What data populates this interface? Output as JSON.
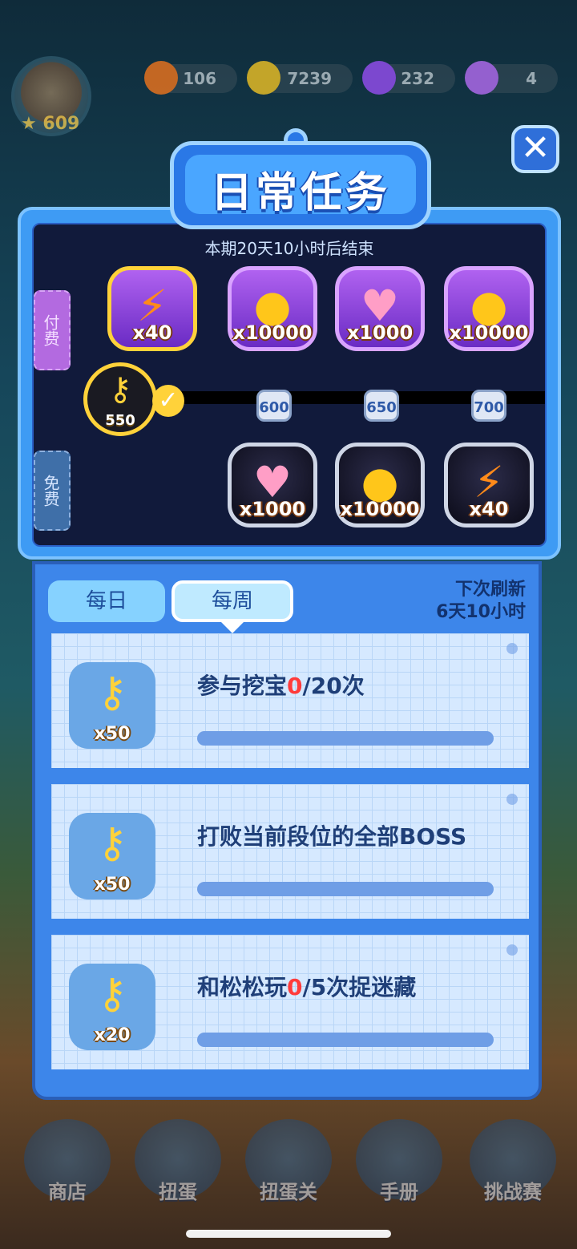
{
  "header": {
    "avatar_stars": "609",
    "resources": [
      {
        "name": "energy",
        "value": "106",
        "color": "#ff7a1a"
      },
      {
        "name": "coins",
        "value": "7239",
        "color": "#ffcc22"
      },
      {
        "name": "gems",
        "value": "232",
        "color": "#a050ff"
      },
      {
        "name": "crowns",
        "value": "4",
        "color": "#c070ff"
      }
    ]
  },
  "panel": {
    "title": "日常任务",
    "period": "本期20天10小时后结束",
    "paid_tab": "付费",
    "free_tab": "免费",
    "current_keys": "550",
    "thresholds": [
      "600",
      "650",
      "700"
    ],
    "paid_rewards": [
      {
        "icon": "lightning-icon",
        "amount": "x40"
      },
      {
        "icon": "coin-icon",
        "amount": "x10000"
      },
      {
        "icon": "heart-icon",
        "amount": "x1000"
      },
      {
        "icon": "coin-icon",
        "amount": "x10000"
      }
    ],
    "free_rewards": [
      {
        "icon": "heart-icon",
        "amount": "x1000"
      },
      {
        "icon": "coin-icon",
        "amount": "x10000"
      },
      {
        "icon": "lightning-icon",
        "amount": "x40"
      }
    ]
  },
  "tasks": {
    "tabs": {
      "daily": "每日",
      "weekly": "每周"
    },
    "refresh_line1": "下次刷新",
    "refresh_line2": "6天10小时",
    "items": [
      {
        "reward": "x50",
        "prefix": "参与挖宝",
        "progress": "0",
        "suffix": "/20次"
      },
      {
        "reward": "x50",
        "prefix": "打败当前段位的全部BOSS",
        "progress": "",
        "suffix": ""
      },
      {
        "reward": "x20",
        "prefix": "和松松玩",
        "progress": "0",
        "suffix": "/5次捉迷藏"
      }
    ]
  },
  "close": "✕",
  "nav": {
    "shop": "商店",
    "gacha": "扭蛋",
    "gacha_level": "扭蛋关",
    "handbook": "手册",
    "challenge": "挑战赛"
  }
}
